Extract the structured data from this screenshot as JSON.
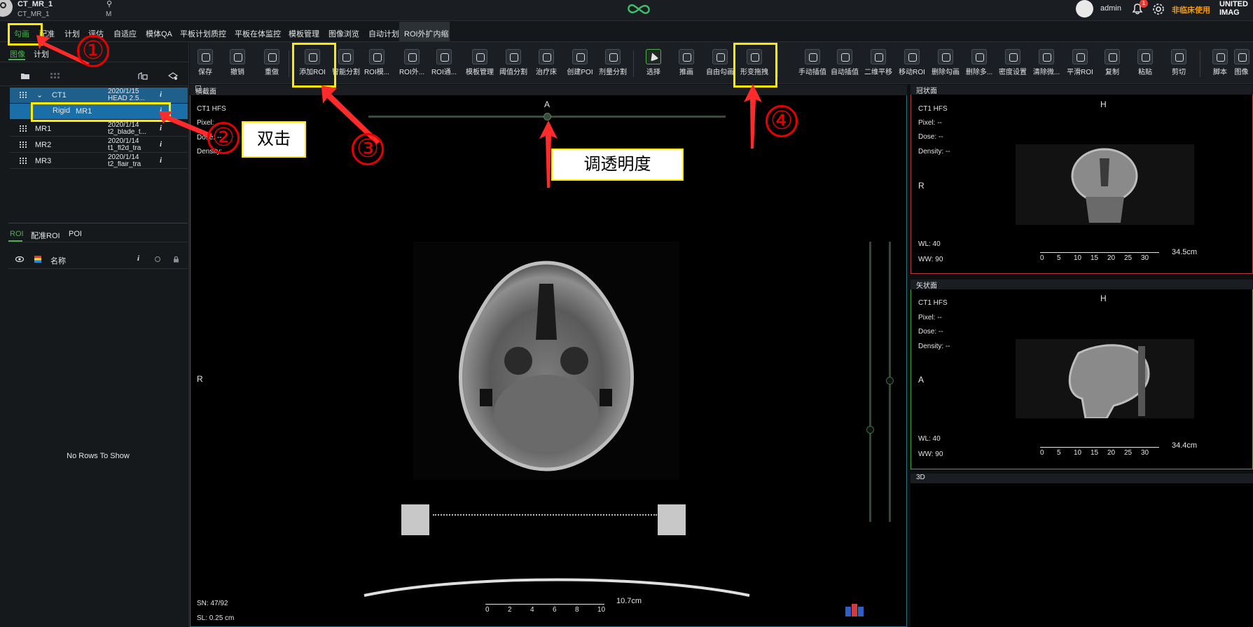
{
  "topbar": {
    "patient_name": "CT_MR_1",
    "patient_sub": "CT_MR_1",
    "sex": "M",
    "user": "admin",
    "notification_count": "1",
    "nonclinical": "非临床使用",
    "brand_line1": "UNITED",
    "brand_line2": "IMAG"
  },
  "menu": [
    {
      "label": "勾画",
      "active": true
    },
    {
      "label": "配准"
    },
    {
      "label": "计划"
    },
    {
      "label": "评估"
    },
    {
      "label": "自适应"
    },
    {
      "label": "模体QA"
    },
    {
      "label": "平板计划质控"
    },
    {
      "label": "平板在体监控"
    },
    {
      "label": "模板管理"
    },
    {
      "label": "图像浏览"
    },
    {
      "label": "自动计划"
    },
    {
      "label": "ROI外扩内缩"
    }
  ],
  "left_panel": {
    "tabs": [
      "图像",
      "计划"
    ],
    "series": [
      {
        "name": "CT1",
        "date": "2020/1/15",
        "desc": "HEAD 2.5...",
        "info": "i"
      },
      {
        "reg": "Rigid",
        "name": "MR1",
        "info": "i"
      },
      {
        "name": "MR1",
        "date": "2020/1/14",
        "desc": "t2_blade_t...",
        "info": "i"
      },
      {
        "name": "MR2",
        "date": "2020/1/14",
        "desc": "t1_fl2d_tra",
        "info": "i"
      },
      {
        "name": "MR3",
        "date": "2020/1/14",
        "desc": "t2_flair_tra",
        "info": "i"
      }
    ],
    "roi_tabs": [
      "ROI",
      "配准ROI",
      "POI"
    ],
    "roi_header": {
      "name": "名称",
      "info": "i"
    },
    "no_rows": "No Rows To Show"
  },
  "toolbar": [
    "保存",
    "撤销",
    "重做",
    "添加ROI",
    "智能分割",
    "ROI模...",
    "ROI外...",
    "ROI通...",
    "模板管理",
    "阈值分割",
    "治疗床",
    "创建POI",
    "剂量分割",
    "选择",
    "推画",
    "自由勾画",
    "形变拖拽",
    "手动插值",
    "自动插值",
    "二维平移",
    "移动ROI",
    "删除勾画",
    "删除多...",
    "密度设置",
    "清除微...",
    "平滑ROI",
    "复制",
    "粘贴",
    "剪切",
    "脚本",
    "图像"
  ],
  "axial": {
    "title": "横截面",
    "series": "CT1 HFS",
    "pixel": "Pixel:",
    "dose": "Dose: --",
    "density": "Density:",
    "orient_top": "A",
    "orient_left": "R",
    "sn": "SN: 47/92",
    "sl": "SL: 0.25 cm",
    "scale_label": "10.7cm",
    "scale_ticks": [
      "0",
      "2",
      "4",
      "6",
      "8",
      "10"
    ],
    "opacity": 0.5
  },
  "coronal": {
    "title": "冠状面",
    "series": "CT1 HFS",
    "pixel": "Pixel: --",
    "dose": "Dose: --",
    "density": "Density: --",
    "orient_top": "H",
    "orient_left": "R",
    "wl": "WL:  40",
    "ww": "WW:  90",
    "scale_label": "34.5cm",
    "scale_ticks": [
      "0",
      "5",
      "10",
      "15",
      "20",
      "25",
      "30"
    ]
  },
  "sagittal": {
    "title": "矢状面",
    "series": "CT1 HFS",
    "pixel": "Pixel: --",
    "dose": "Dose: --",
    "density": "Density: --",
    "orient_top": "H",
    "orient_left": "A",
    "wl": "WL:  40",
    "ww": "WW:  90",
    "scale_label": "34.4cm",
    "scale_ticks": [
      "0",
      "5",
      "10",
      "15",
      "20",
      "25",
      "30"
    ]
  },
  "view3d": {
    "title": "3D"
  },
  "annotations": {
    "n1": "①",
    "n2": "②",
    "n3": "③",
    "n4": "④",
    "double_click": "双击",
    "adjust_opacity": "调透明度"
  }
}
